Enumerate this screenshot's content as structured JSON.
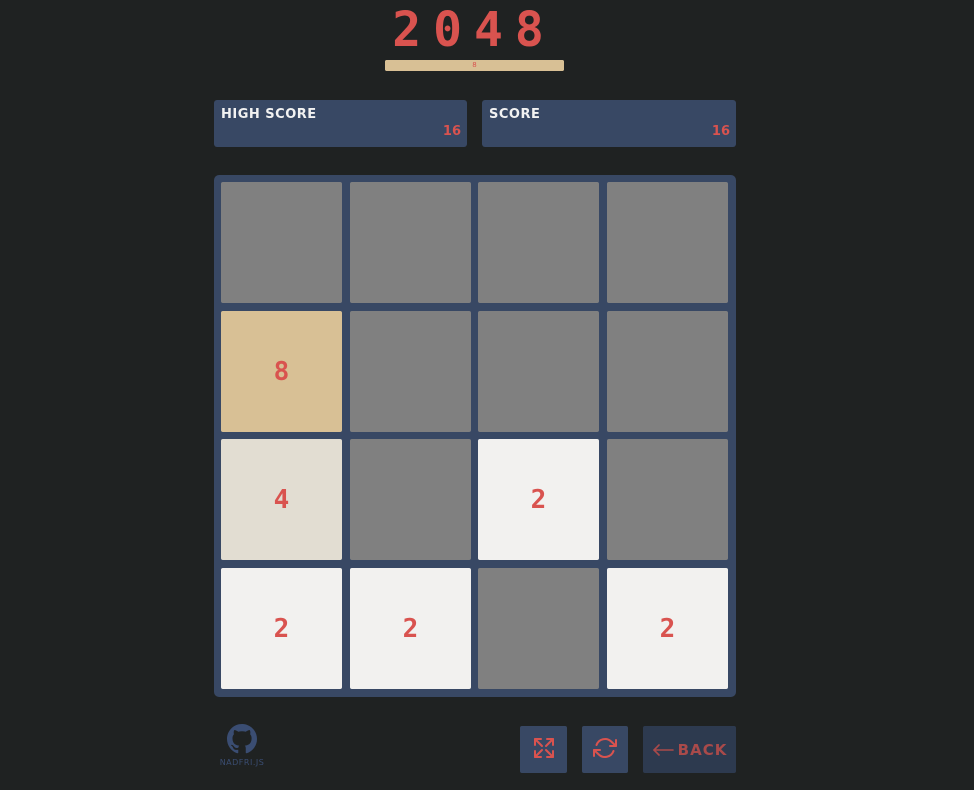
{
  "title": "2048",
  "progress": {
    "label": "8",
    "fraction": 1.0
  },
  "scores": {
    "high_score_label": "HIGH SCORE",
    "high_score_value": "16",
    "score_label": "SCORE",
    "score_value": "16"
  },
  "board": {
    "rows": [
      [
        "",
        "",
        "",
        ""
      ],
      [
        "8",
        "",
        "",
        ""
      ],
      [
        "4",
        "",
        "2",
        ""
      ],
      [
        "2",
        "2",
        "",
        "2"
      ]
    ]
  },
  "footer": {
    "github_label": "NADFRI.JS",
    "back_label": "BACK",
    "fullscreen_icon": "expand-icon",
    "restart_icon": "refresh-icon"
  },
  "colors": {
    "background": "#1f2222",
    "panel": "#384864",
    "accent": "#d9534f",
    "empty_tile": "#808080",
    "tile_2": "#f2f1ef",
    "tile_4": "#e2ddd2",
    "tile_8": "#d8c095"
  }
}
